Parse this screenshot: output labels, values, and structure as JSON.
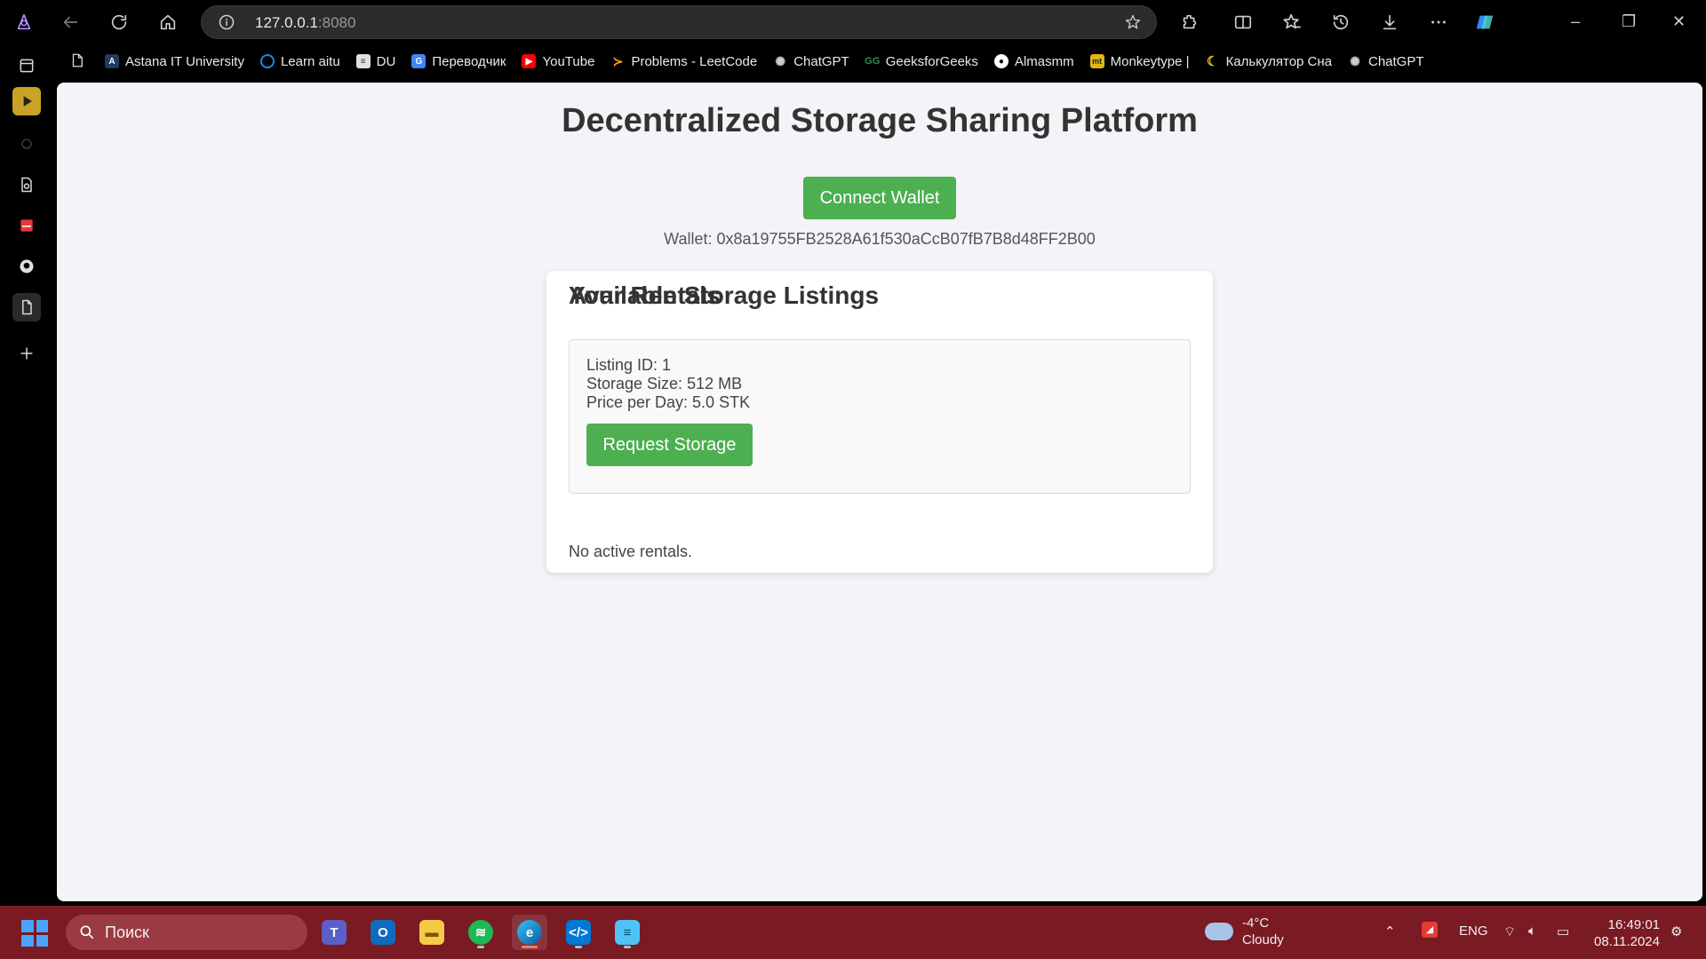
{
  "browser": {
    "url_host": "127.0.0.1",
    "url_port": ":8080"
  },
  "bookmarks": [
    {
      "label": "Astana IT University",
      "icon": "astana-it-icon",
      "color": "#1e3a5f"
    },
    {
      "label": "Learn aitu",
      "icon": "learn-aitu-icon",
      "color": "#1e88e5"
    },
    {
      "label": "DU",
      "icon": "du-icon",
      "color": "#e0e0e0"
    },
    {
      "label": "Переводчик",
      "icon": "translate-icon",
      "color": "#4285f4"
    },
    {
      "label": "YouTube",
      "icon": "youtube-icon",
      "color": "#ff0000"
    },
    {
      "label": "Problems - LeetCode",
      "icon": "leetcode-icon",
      "color": "#ffa116"
    },
    {
      "label": "ChatGPT",
      "icon": "chatgpt-icon",
      "color": "#555555"
    },
    {
      "label": "GeeksforGeeks",
      "icon": "geeksforgeeks-icon",
      "color": "#2f8d46"
    },
    {
      "label": "Almasmm",
      "icon": "github-icon",
      "color": "#333333"
    },
    {
      "label": "Monkeytype |",
      "icon": "monkeytype-icon",
      "color": "#e2b714"
    },
    {
      "label": "Калькулятор Сна",
      "icon": "moon-icon",
      "color": "#f4c430"
    },
    {
      "label": "ChatGPT",
      "icon": "chatgpt-icon",
      "color": "#555555"
    }
  ],
  "page": {
    "title": "Decentralized Storage Sharing Platform",
    "connect_button": "Connect Wallet",
    "wallet_text": "Wallet: 0x8a19755FB2528A61f530aCcB07fB7B8d48FF2B00",
    "listings_heading": "Available Storage Listings",
    "listing": {
      "id_line": "Listing ID: 1",
      "size_line": "Storage Size: 512 MB",
      "price_line": "Price per Day: 5.0 STK",
      "button": "Request Storage"
    },
    "rentals_heading": "Your Rentals",
    "rentals_empty": "No active rentals.",
    "accent_color": "#4caf50"
  },
  "taskbar": {
    "search_placeholder": "Поиск",
    "weather_temp": "-4°C",
    "weather_desc": "Cloudy",
    "language": "ENG",
    "time": "16:49:01",
    "date": "08.11.2024"
  }
}
